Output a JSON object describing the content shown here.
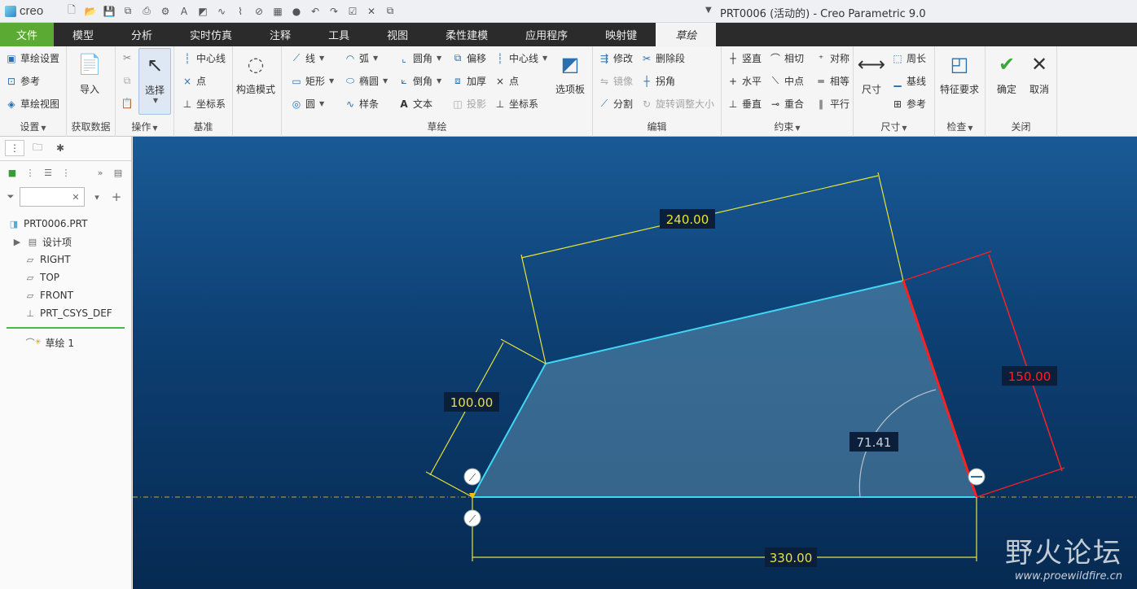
{
  "app": {
    "logo": "creo",
    "title": "PRT0006 (活动的) - Creo Parametric 9.0"
  },
  "qat_icons": [
    "new-icon",
    "open-icon",
    "save-icon",
    "regenerate-icon",
    "undo-icon",
    "redo-icon",
    "window-icon",
    "close-icon"
  ],
  "tabs": [
    "文件",
    "模型",
    "分析",
    "实时仿真",
    "注释",
    "工具",
    "视图",
    "柔性建模",
    "应用程序",
    "映射键",
    "草绘"
  ],
  "ribbon": {
    "setup": {
      "label": "设置",
      "items": [
        "草绘设置",
        "参考",
        "草绘视图"
      ]
    },
    "get_data": {
      "label": "获取数据",
      "import": "导入"
    },
    "operations": {
      "label": "操作",
      "select": "选择"
    },
    "datum": {
      "label": "基准",
      "items": [
        "中心线",
        "点",
        "坐标系"
      ]
    },
    "construction": {
      "label": "构造模式"
    },
    "sketch": {
      "label": "草绘",
      "col1": [
        "线",
        "矩形",
        "圆"
      ],
      "col2": [
        "弧",
        "椭圆",
        "样条"
      ],
      "col3": [
        "圆角",
        "倒角",
        "文本"
      ],
      "col4": [
        "偏移",
        "加厚",
        "投影"
      ],
      "col5": [
        "中心线",
        "点",
        "坐标系"
      ],
      "palette": "选项板"
    },
    "edit": {
      "label": "编辑",
      "items": [
        "修改",
        "删除段",
        "镜像",
        "拐角",
        "分割",
        "旋转调整大小"
      ]
    },
    "constraint": {
      "label": "约束",
      "items": [
        "竖直",
        "相切",
        "对称",
        "水平",
        "中点",
        "相等",
        "垂直",
        "重合",
        "平行"
      ]
    },
    "dimension": {
      "label": "尺寸",
      "main": "尺寸",
      "items": [
        "周长",
        "基线",
        "参考"
      ]
    },
    "inspect": {
      "label": "检查",
      "main": "特征要求"
    },
    "close": {
      "label": "关闭",
      "ok": "确定",
      "cancel": "取消"
    }
  },
  "tree": {
    "filter_placeholder": "",
    "items": [
      "PRT0006.PRT",
      "设计项",
      "RIGHT",
      "TOP",
      "FRONT",
      "PRT_CSYS_DEF"
    ],
    "sketch": "草绘 1"
  },
  "dimensions": {
    "top": "240.00",
    "left": "100.00",
    "right": "150.00",
    "angle": "71.41",
    "bottom": "330.00"
  },
  "watermark": {
    "main": "野火论坛",
    "sub": "www.proewildfire.cn"
  },
  "colors": {
    "sketch": "#3fd7f5",
    "dim": "#e7e23a",
    "selected": "#ff2020",
    "fill": "#5d8fb0",
    "file_tab": "#5aaa33"
  }
}
